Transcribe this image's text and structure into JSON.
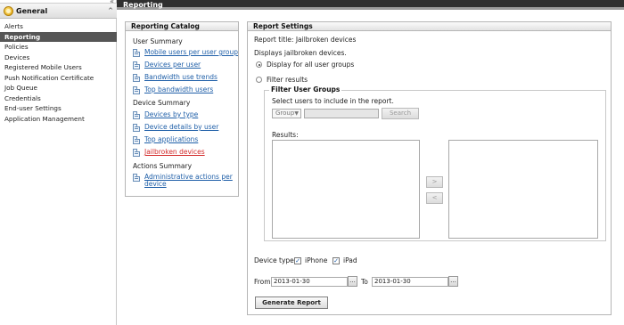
{
  "sidebar": {
    "collapse_icon": "«",
    "header": {
      "title": "General",
      "icon": "general-icon",
      "caret": "^"
    },
    "items": [
      {
        "label": "Alerts"
      },
      {
        "label": "Reporting"
      },
      {
        "label": "Policies"
      },
      {
        "label": "Devices"
      },
      {
        "label": "Registered Mobile Users"
      },
      {
        "label": "Push Notification Certificate"
      },
      {
        "label": "Job Queue"
      },
      {
        "label": "Credentials"
      },
      {
        "label": "End-user Settings"
      },
      {
        "label": "Application Management"
      }
    ],
    "active_index": 1
  },
  "topbar": {
    "title": "Reporting"
  },
  "catalog": {
    "title": "Reporting Catalog",
    "sections": [
      {
        "title": "User Summary",
        "links": [
          "Mobile users per user group",
          "Devices per user",
          "Bandwidth use trends",
          "Top bandwidth users"
        ]
      },
      {
        "title": "Device Summary",
        "links": [
          "Devices by type",
          "Device details by user",
          "Top applications",
          "Jailbroken devices"
        ]
      },
      {
        "title": "Actions Summary",
        "links": [
          "Administrative actions per device"
        ]
      }
    ]
  },
  "settings": {
    "title": "Report Settings",
    "report_title": "Report title: Jailbroken devices",
    "description": "Displays jailbroken devices.",
    "radio_all": "Display for all user groups",
    "radio_filter": "Filter results",
    "filter": {
      "legend": "Filter User Groups",
      "instruction": "Select users to include in the report.",
      "group_select": "Group",
      "search_button": "Search",
      "results_label": "Results:",
      "add_button": ">",
      "remove_button": "<"
    },
    "device_type": {
      "label": "Device type",
      "iphone": "iPhone",
      "ipad": "iPad"
    },
    "date": {
      "from_label": "From",
      "from_value": "2013-01-30",
      "to_label": "To",
      "to_value": "2013-01-30",
      "calendar_glyph": "..."
    },
    "generate_button": "Generate Report"
  },
  "colors": {
    "topbar": "#2f2f2f",
    "sidebar_active": "#565656",
    "link": "#1f5fa8",
    "link_alert": "#d32a2a"
  }
}
